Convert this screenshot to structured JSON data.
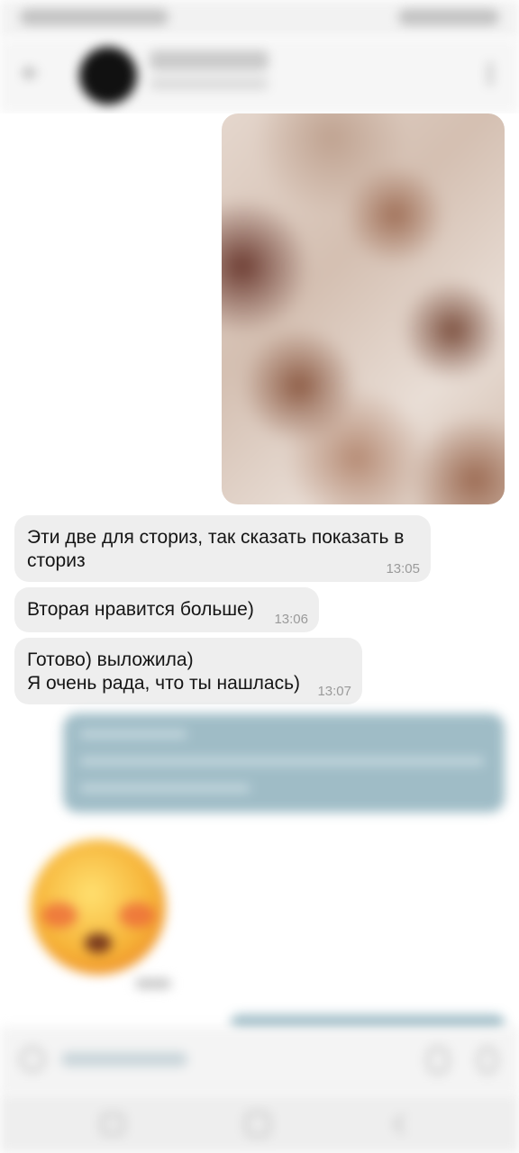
{
  "messages": [
    {
      "text": "Эти две для сториз, так сказать показать в\nсториз",
      "time": "13:05"
    },
    {
      "text": "Вторая нравится больше)",
      "time": "13:06"
    },
    {
      "text": "Готово) выложила)\nЯ очень рада, что ты нашлась)",
      "time": "13:07"
    }
  ],
  "icons": {
    "back": "arrow-left-icon",
    "menu": "more-vertical-icon",
    "emoji": "emoji-icon",
    "attach": "paperclip-icon",
    "mic": "microphone-icon"
  },
  "colors": {
    "incoming_bubble": "#eeeeee",
    "outgoing_bubble": "#8fb1bd"
  }
}
